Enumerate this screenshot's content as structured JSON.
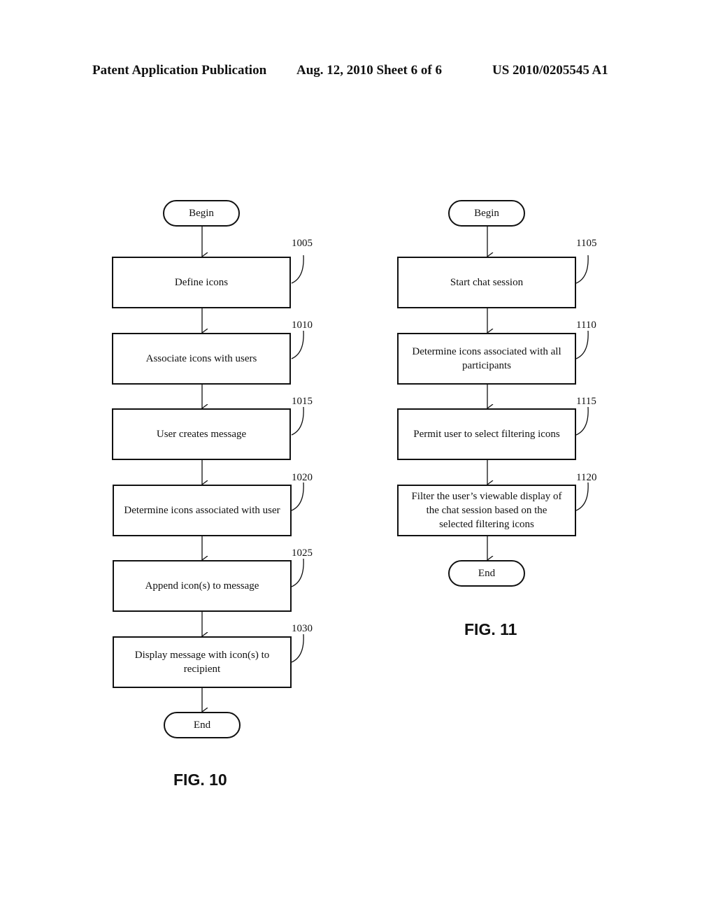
{
  "header": {
    "publication": "Patent Application Publication",
    "date_sheet": "Aug. 12, 2010  Sheet 6 of 6",
    "number": "US 2010/0205545 A1"
  },
  "fig10": {
    "caption": "FIG. 10",
    "begin": "Begin",
    "end": "End",
    "steps": [
      {
        "ref": "1005",
        "text": "Define icons"
      },
      {
        "ref": "1010",
        "text": "Associate icons with users"
      },
      {
        "ref": "1015",
        "text": "User creates message"
      },
      {
        "ref": "1020",
        "text": "Determine icons associated with user"
      },
      {
        "ref": "1025",
        "text": "Append icon(s) to message"
      },
      {
        "ref": "1030",
        "text": "Display message with icon(s) to recipient"
      }
    ]
  },
  "fig11": {
    "caption": "FIG. 11",
    "begin": "Begin",
    "end": "End",
    "steps": [
      {
        "ref": "1105",
        "text": "Start chat session"
      },
      {
        "ref": "1110",
        "text": "Determine icons associated with all participants"
      },
      {
        "ref": "1115",
        "text": "Permit user to select filtering icons"
      },
      {
        "ref": "1120",
        "text": "Filter the user’s viewable display of the chat session based on the selected filtering icons"
      }
    ]
  }
}
